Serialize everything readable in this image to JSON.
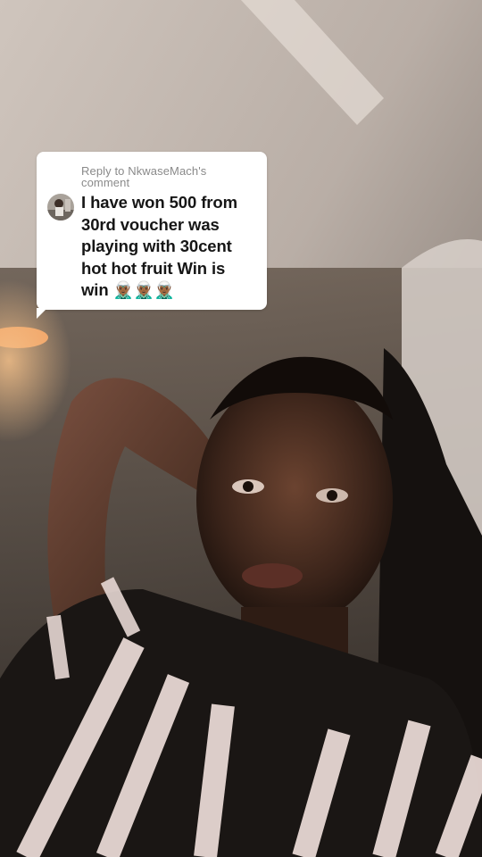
{
  "reply_card": {
    "header": "Reply to NkwaseMach's comment",
    "comment": "I have won 500 from 30rd voucher was playing with 30cent hot hot fruit Win is win 🧝🏾‍♂️🧝🏾‍♂️🧝🏾‍♂️"
  },
  "colors": {
    "card_background": "#ffffff",
    "comment_text": "#161616",
    "header_text": "#8a8a8a"
  },
  "icons": {
    "avatar": "commenter-avatar"
  }
}
